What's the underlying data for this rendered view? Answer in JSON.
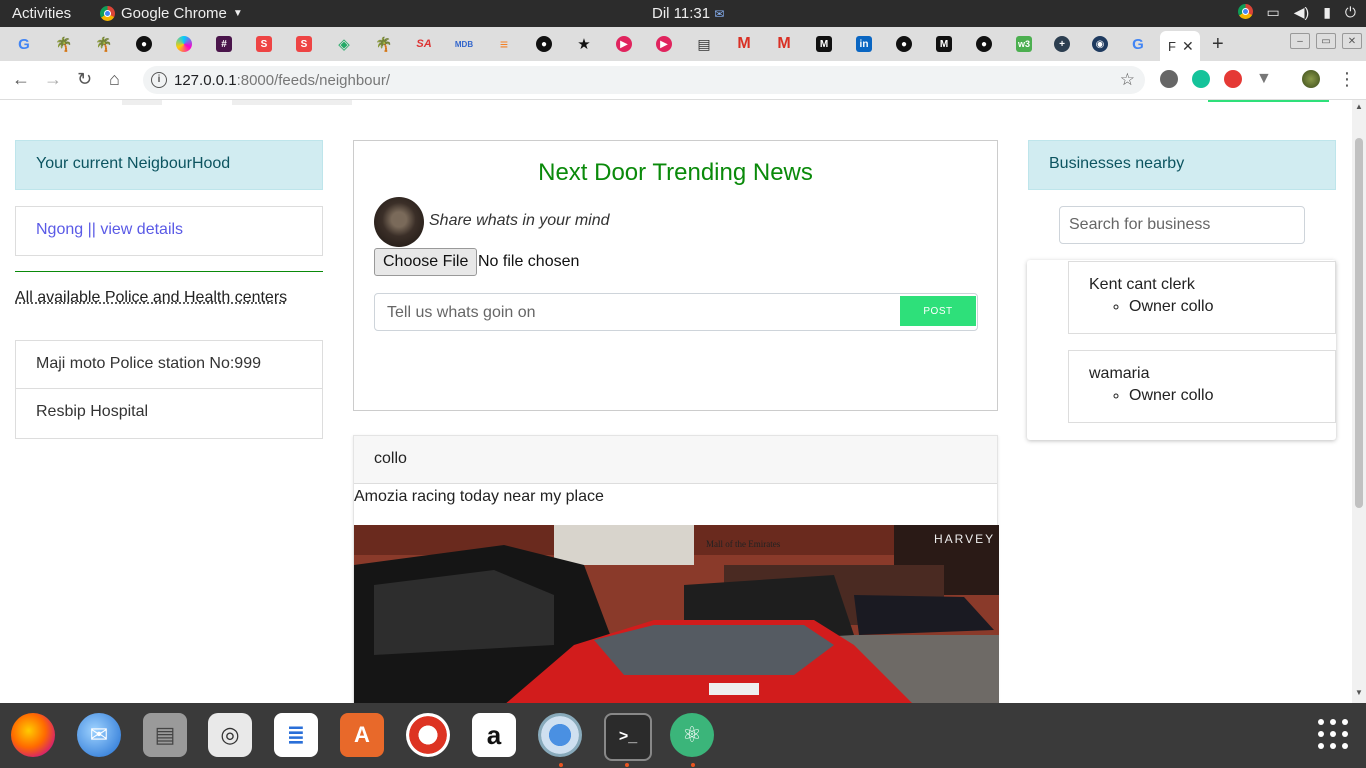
{
  "system": {
    "activities": "Activities",
    "app_name": "Google Chrome",
    "clock": "Dil 11:31"
  },
  "browser": {
    "active_tab_label": "F",
    "url_host": "127.0.0.1",
    "url_path": ":8000/feeds/neighbour/"
  },
  "left": {
    "neighbourhood_header": "Your current NeigbourHood",
    "neighbourhood_link": "Ngong || view details",
    "services_heading": "All available Police and Health centers",
    "services": [
      "Maji moto Police station No:999",
      "Resbip Hospital"
    ]
  },
  "post_form": {
    "title": "Next Door Trending News",
    "share_prompt": "Share whats in your mind",
    "file_button": "Choose File",
    "file_status": "No file chosen",
    "input_placeholder": "Tell us whats goin on",
    "post_button": "POST"
  },
  "feed": [
    {
      "author": "collo",
      "text": "Amozia racing today near my place"
    }
  ],
  "right": {
    "businesses_header": "Businesses nearby",
    "search_placeholder": "Search for business",
    "businesses": [
      {
        "name": "Kent cant clerk",
        "owner": "Owner collo"
      },
      {
        "name": "wamaria",
        "owner": "Owner collo"
      }
    ]
  },
  "colors": {
    "accent_green": "#0a8a0a",
    "post_button": "#2ee07a",
    "info_bg": "#d1ecf1",
    "info_text": "#0c5460"
  },
  "dock_apps": [
    "firefox-icon",
    "thunderbird-icon",
    "files-icon",
    "rhythmbox-icon",
    "writer-icon",
    "software-icon",
    "help-icon",
    "amazon-icon",
    "chrome-icon",
    "terminal-icon",
    "atom-icon"
  ]
}
